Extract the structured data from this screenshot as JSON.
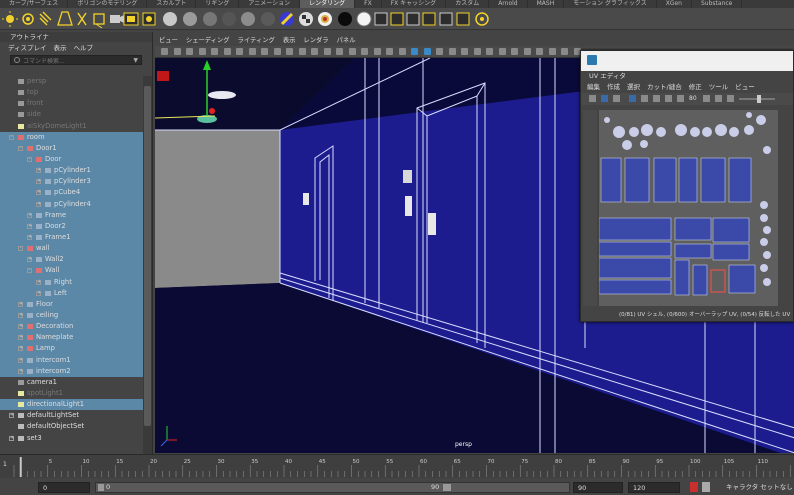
{
  "shelf_tabs": [
    {
      "label": "カーブ/サーフェス",
      "active": false
    },
    {
      "label": "ポリゴンのモデリング",
      "active": false
    },
    {
      "label": "スカルプト",
      "active": false
    },
    {
      "label": "リギング",
      "active": false
    },
    {
      "label": "アニメーション",
      "active": false
    },
    {
      "label": "レンダリング",
      "active": true
    },
    {
      "label": "FX",
      "active": false
    },
    {
      "label": "FX キャッシング",
      "active": false
    },
    {
      "label": "カスタム",
      "active": false
    },
    {
      "label": "Arnold",
      "active": false
    },
    {
      "label": "MASH",
      "active": false
    },
    {
      "label": "モーション グラフィックス",
      "active": false
    },
    {
      "label": "XGen",
      "active": false
    },
    {
      "label": "Substance",
      "active": false
    }
  ],
  "outliner": {
    "title": "アウトライナ",
    "menu": [
      "ディスプレイ",
      "表示",
      "ヘルプ"
    ],
    "search_placeholder": "コマンド検索...",
    "items": [
      {
        "label": "persp",
        "indent": 0,
        "expand": "",
        "icon": "camera",
        "selected": false,
        "dim": true
      },
      {
        "label": "top",
        "indent": 0,
        "expand": "",
        "icon": "camera",
        "selected": false,
        "dim": true
      },
      {
        "label": "front",
        "indent": 0,
        "expand": "",
        "icon": "camera",
        "selected": false,
        "dim": true
      },
      {
        "label": "side",
        "indent": 0,
        "expand": "",
        "icon": "camera",
        "selected": false,
        "dim": true
      },
      {
        "label": "aiSkyDomeLight1",
        "indent": 0,
        "expand": "",
        "icon": "light",
        "selected": false,
        "dim": true
      },
      {
        "label": "room",
        "indent": 0,
        "expand": "-",
        "icon": "group",
        "selected": true,
        "dim": false
      },
      {
        "label": "Door1",
        "indent": 1,
        "expand": "-",
        "icon": "group",
        "selected": true,
        "dim": false
      },
      {
        "label": "Door",
        "indent": 2,
        "expand": "-",
        "icon": "group",
        "selected": true,
        "dim": false
      },
      {
        "label": "pCylinder1",
        "indent": 3,
        "expand": "+",
        "icon": "mesh",
        "selected": true,
        "dim": false
      },
      {
        "label": "pCylinder3",
        "indent": 3,
        "expand": "+",
        "icon": "mesh",
        "selected": true,
        "dim": false
      },
      {
        "label": "pCube4",
        "indent": 3,
        "expand": "+",
        "icon": "mesh",
        "selected": true,
        "dim": false
      },
      {
        "label": "pCylinder4",
        "indent": 3,
        "expand": "+",
        "icon": "mesh",
        "selected": true,
        "dim": false
      },
      {
        "label": "Frame",
        "indent": 2,
        "expand": "+",
        "icon": "mesh",
        "selected": true,
        "dim": false
      },
      {
        "label": "Door2",
        "indent": 2,
        "expand": "+",
        "icon": "mesh",
        "selected": true,
        "dim": false
      },
      {
        "label": "Frame1",
        "indent": 2,
        "expand": "+",
        "icon": "mesh",
        "selected": true,
        "dim": false
      },
      {
        "label": "wall",
        "indent": 1,
        "expand": "-",
        "icon": "group",
        "selected": true,
        "dim": false
      },
      {
        "label": "Wall2",
        "indent": 2,
        "expand": "+",
        "icon": "mesh",
        "selected": true,
        "dim": false
      },
      {
        "label": "Wall",
        "indent": 2,
        "expand": "-",
        "icon": "group",
        "selected": true,
        "dim": false
      },
      {
        "label": "Right",
        "indent": 3,
        "expand": "+",
        "icon": "mesh",
        "selected": true,
        "dim": false
      },
      {
        "label": "Left",
        "indent": 3,
        "expand": "+",
        "icon": "mesh",
        "selected": true,
        "dim": false
      },
      {
        "label": "Floor",
        "indent": 1,
        "expand": "+",
        "icon": "mesh",
        "selected": true,
        "dim": false
      },
      {
        "label": "ceiling",
        "indent": 1,
        "expand": "+",
        "icon": "mesh",
        "selected": true,
        "dim": false
      },
      {
        "label": "Decoration",
        "indent": 1,
        "expand": "+",
        "icon": "group",
        "selected": true,
        "dim": false
      },
      {
        "label": "Nameplate",
        "indent": 1,
        "expand": "+",
        "icon": "group",
        "selected": true,
        "dim": false
      },
      {
        "label": "Lamp",
        "indent": 1,
        "expand": "+",
        "icon": "group",
        "selected": true,
        "dim": false
      },
      {
        "label": "intercom1",
        "indent": 1,
        "expand": "+",
        "icon": "mesh",
        "selected": true,
        "dim": false
      },
      {
        "label": "intercom2",
        "indent": 1,
        "expand": "+",
        "icon": "mesh",
        "selected": true,
        "dim": false
      },
      {
        "label": "camera1",
        "indent": 0,
        "expand": "",
        "icon": "camera",
        "selected": false,
        "dim": false
      },
      {
        "label": "spotLight1",
        "indent": 0,
        "expand": "",
        "icon": "light",
        "selected": false,
        "dim": true
      },
      {
        "label": "directionalLight1",
        "indent": 0,
        "expand": "",
        "icon": "light",
        "selected": true,
        "dim": false
      },
      {
        "label": "defaultLightSet",
        "indent": 0,
        "expand": "+",
        "icon": "set",
        "selected": false,
        "dim": false
      },
      {
        "label": "defaultObjectSet",
        "indent": 0,
        "expand": "",
        "icon": "set",
        "selected": false,
        "dim": false
      },
      {
        "label": "set3",
        "indent": 0,
        "expand": "+",
        "icon": "set",
        "selected": false,
        "dim": false
      }
    ]
  },
  "viewport": {
    "menu": [
      "ビュー",
      "シェーディング",
      "ライティング",
      "表示",
      "レンダラ",
      "パネル"
    ],
    "camera_label": "persp"
  },
  "uv_editor": {
    "title": "UV エディタ",
    "menu": [
      "編集",
      "作成",
      "選択",
      "カット/縫合",
      "修正",
      "ツール",
      "ビュー"
    ],
    "resolution": "80",
    "status": "(0/81) UV シェル, (0/600) オーバーラップ UV, (0/54) 反転した UV"
  },
  "time_slider": {
    "ticks": [
      "5",
      "10",
      "15",
      "20",
      "25",
      "30",
      "35",
      "40",
      "45",
      "50",
      "55",
      "60",
      "65",
      "70",
      "75",
      "80",
      "85",
      "90",
      "95",
      "100",
      "105",
      "110",
      "115"
    ],
    "current_frame": "1"
  },
  "range_slider": {
    "start": "0",
    "range_start": "0",
    "range_end": "90",
    "end": "90",
    "max": "120",
    "character_set": "キャラクタ セットなし"
  },
  "colors": {
    "selection": "#5c88a8",
    "viewport_blue": "#1c1c8e",
    "wireframe": "#d8dcff",
    "uv_shell": "#3b4aa8"
  }
}
